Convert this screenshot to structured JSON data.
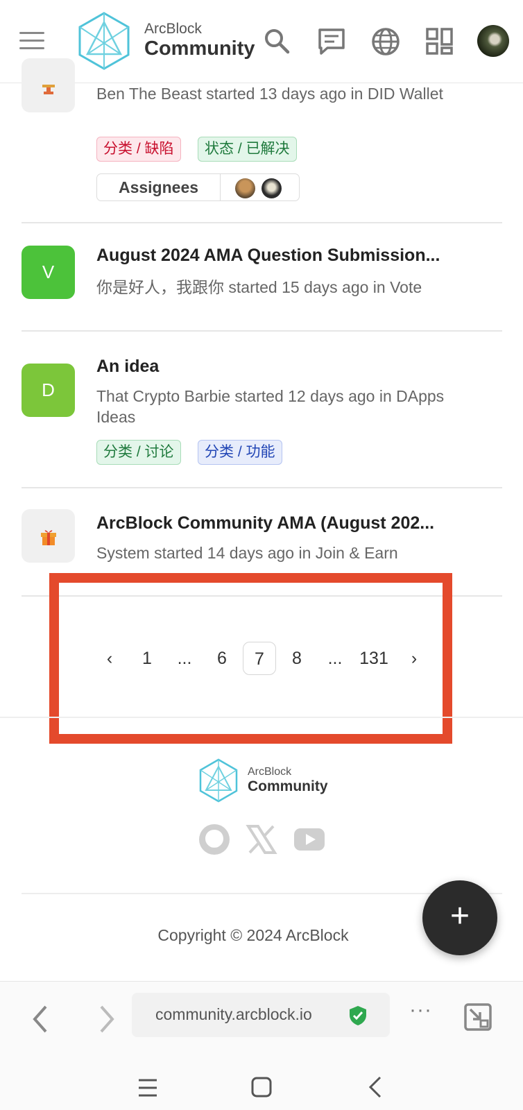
{
  "header": {
    "logo_small": "ArcBlock",
    "logo_big": "Community",
    "icons": [
      "menu-icon",
      "search-icon",
      "chat-icon",
      "globe-icon",
      "apps-icon",
      "avatar"
    ]
  },
  "topics": [
    {
      "icon": "trophy-icon",
      "meta": "Ben The Beast started 13 days ago in DID Wallet",
      "tags": [
        "分类 / 缺陷",
        "状态 / 已解决"
      ],
      "assignees_label": "Assignees"
    },
    {
      "icon_letter": "V",
      "icon_color": "#4cc23a",
      "title": "August 2024 AMA Question Submission...",
      "meta": "你是好人，我跟你 started 15 days ago in Vote"
    },
    {
      "icon_letter": "D",
      "icon_color": "#7cc63a",
      "title": "An idea",
      "meta": "That Crypto Barbie started 12 days ago in DApps Ideas",
      "tags": [
        "分类 / 讨论",
        "分类 / 功能"
      ]
    },
    {
      "icon": "gift-icon",
      "title": "ArcBlock Community AMA (August 202...",
      "meta": "System started 14 days ago in Join & Earn"
    }
  ],
  "pagination": {
    "prev": "‹",
    "pages": [
      "1",
      "...",
      "6",
      "7",
      "8",
      "...",
      "131"
    ],
    "current": "7",
    "next": "›"
  },
  "footer": {
    "logo_small": "ArcBlock",
    "logo_big": "Community",
    "social": [
      "github-icon",
      "x-icon",
      "youtube-icon"
    ],
    "copyright": "Copyright © 2024 ArcBlock"
  },
  "fab_label": "+",
  "browser": {
    "url": "community.arcblock.io",
    "menu": "···"
  },
  "colors": {
    "highlight": "#e44a2c",
    "fab": "#2b2b2b",
    "logo_accent": "#4fc3d9"
  }
}
